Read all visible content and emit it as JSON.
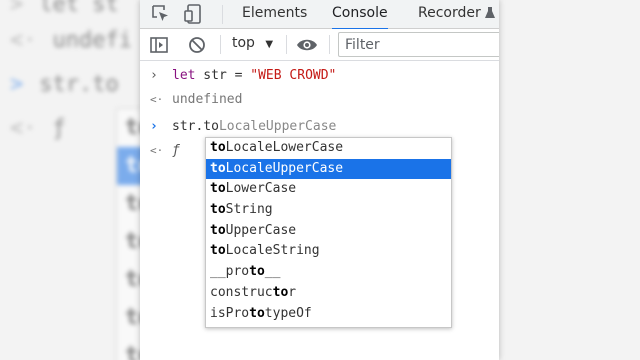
{
  "tabs": [
    {
      "label": "Elements",
      "active": false
    },
    {
      "label": "Console",
      "active": true
    },
    {
      "label": "Recorder",
      "active": false
    }
  ],
  "toolbar": {
    "context": "top",
    "filter_placeholder": "Filter"
  },
  "console": {
    "line1": {
      "keyword": "let",
      "name": " str = ",
      "value": "\"WEB CROWD\""
    },
    "line2": "undefined",
    "input_typed": "str.to",
    "input_hint": "LocaleUpperCase",
    "result_symbol": "ƒ"
  },
  "autocomplete": [
    {
      "prefix": "to",
      "rest": "LocaleLowerCase",
      "selected": false
    },
    {
      "prefix": "to",
      "rest": "LocaleUpperCase",
      "selected": true
    },
    {
      "prefix": "to",
      "rest": "LowerCase",
      "selected": false
    },
    {
      "prefix": "to",
      "rest": "String",
      "selected": false
    },
    {
      "prefix": "to",
      "rest": "UpperCase",
      "selected": false
    },
    {
      "prefix": "to",
      "rest": "LocaleString",
      "selected": false
    },
    {
      "pre": "__pro",
      "prefix": "to",
      "rest": "__",
      "selected": false
    },
    {
      "pre": "construc",
      "prefix": "to",
      "rest": "r",
      "selected": false
    },
    {
      "pre": "isPro",
      "prefix": "to",
      "rest": "typeOf",
      "selected": false
    }
  ],
  "background": {
    "lines": [
      "let st",
      "undefi",
      "str.to",
      "ƒ"
    ],
    "list": [
      "to",
      "to",
      "to",
      "to",
      "to",
      "to",
      "to",
      "to",
      "to"
    ]
  },
  "colors": {
    "accent": "#1a73e8",
    "keyword": "#881280",
    "string": "#c41a16"
  }
}
